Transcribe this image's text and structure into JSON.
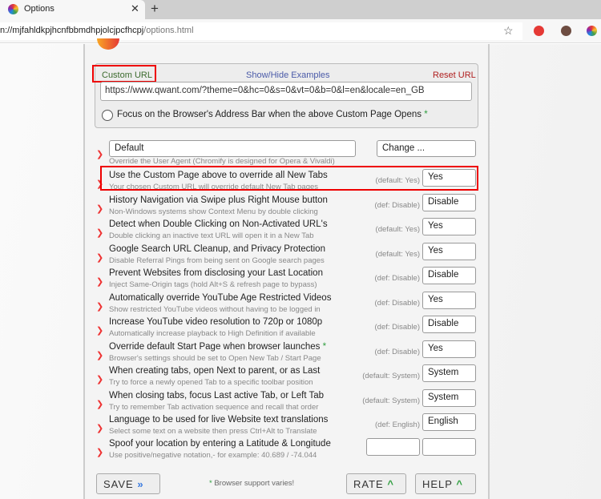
{
  "browser": {
    "tab_title": "Options",
    "url_main": "n://mjfahldkpjhcnfbbmdhpjolcjpcfhcpj",
    "url_path": "/options.html"
  },
  "custom": {
    "label": "Custom URL",
    "examples": "Show/Hide Examples",
    "reset": "Reset URL",
    "value": "https://www.qwant.com/?theme=0&hc=0&s=0&vt=0&b=0&l=en&locale=en_GB",
    "focus_label": "Focus on the Browser's Address Bar when the above Custom Page Opens",
    "star": "*"
  },
  "ua": {
    "value": "Default",
    "button": "Change ...",
    "sub": "Override the User Agent (Chromify is designed for Opera & Vivaldi)"
  },
  "rows": [
    {
      "title": "Use the Custom Page above to override all New Tabs",
      "sub": "Your chosen Custom URL will override default New Tab pages",
      "def": "(default: Yes)",
      "value": "Yes"
    },
    {
      "title": "History Navigation via Swipe plus Right Mouse button",
      "sub": "Non-Windows systems show Context Menu by double clicking",
      "def": "(def: Disable)",
      "value": "Disable"
    },
    {
      "title": "Detect when Double Clicking on Non-Activated URL's",
      "sub": "Double clicking an inactive text URL will open it in a New Tab",
      "def": "(default: Yes)",
      "value": "Yes"
    },
    {
      "title": "Google Search URL Cleanup, and Privacy Protection",
      "sub": "Disable Referral Pings from being sent on Google search pages",
      "def": "(default: Yes)",
      "value": "Yes"
    },
    {
      "title": "Prevent Websites from disclosing your Last Location",
      "sub": "Inject Same-Origin tags (hold Alt+S & refresh page to bypass)",
      "def": "(def: Disable)",
      "value": "Disable"
    },
    {
      "title": "Automatically override YouTube Age Restricted Videos",
      "sub": "Show restricted YouTube videos without having to be logged in",
      "def": "(def: Disable)",
      "value": "Yes"
    },
    {
      "title": "Increase YouTube video resolution to 720p or 1080p",
      "sub": "Automatically increase playback to High Definition if available",
      "def": "(def: Disable)",
      "value": "Disable"
    },
    {
      "title": "Override default Start Page when browser launches",
      "star": "*",
      "sub": "Browser's settings should be set to Open New Tab / Start Page",
      "def": "(def: Disable)",
      "value": "Yes"
    },
    {
      "title": "When creating tabs, open Next to parent, or as Last",
      "sub": "Try to force a newly opened Tab to a specific toolbar position",
      "def": "(default: System)",
      "value": "System"
    },
    {
      "title": "When closing tabs, focus Last active Tab, or Left Tab",
      "sub": "Try to remember Tab activation sequence and recall that order",
      "def": "(default: System)",
      "value": "System"
    },
    {
      "title": "Language to be used for live Website text translations",
      "sub": "Select some text on a website then press Ctrl+Alt to Translate",
      "def": "(def: English)",
      "value": "English"
    }
  ],
  "spoof": {
    "title": "Spoof your location by entering a Latitude & Longitude",
    "sub": "Use positive/negative notation,- for example: 40.689 / -74.044",
    "lat": "",
    "lon": ""
  },
  "footer": {
    "save": "SAVE",
    "save_icon": "»",
    "note_star": "*",
    "note": " Browser support varies!",
    "rate": "RATE",
    "help": "HELP",
    "caret": "^"
  },
  "colors": {
    "accent_red": "#e00000",
    "green": "#2e9e3e",
    "blue": "#3a7be0"
  }
}
